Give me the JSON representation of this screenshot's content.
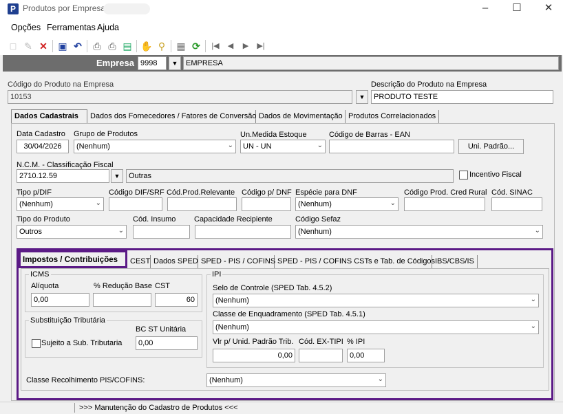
{
  "window": {
    "title": "Produtos por Empresa"
  },
  "menu": [
    "Opções",
    "Ferramentas",
    "Ajuda"
  ],
  "toolbar": {
    "icons": [
      "new-icon",
      "edit-icon",
      "delete-icon",
      "save-icon",
      "undo-icon",
      "print-icon",
      "print-setup-icon",
      "export-icon",
      "hand-icon",
      "search-icon",
      "settings-icon",
      "refresh-icon",
      "first-record-icon",
      "previous-record-icon",
      "next-record-icon",
      "last-record-icon"
    ]
  },
  "empresa": {
    "label": "Empresa",
    "code": "9998",
    "name": "EMPRESA"
  },
  "produto": {
    "code_label": "Código do Produto na Empresa",
    "code": "10153",
    "desc_label": "Descrição do Produto na Empresa",
    "desc": "PRODUTO TESTE"
  },
  "tabs": [
    "Dados Cadastrais",
    "Dados dos Fornecedores / Fatores de Conversão",
    "Dados de Movimentação",
    "Produtos Correlacionados"
  ],
  "cadastro": {
    "data_cadastro_label": "Data Cadastro",
    "data_cadastro": "30/04/2026",
    "grupo_label": "Grupo de Produtos",
    "grupo": "(Nenhum)",
    "unmed_label": "Un.Medida Estoque",
    "unmed": "UN - UN",
    "ean_label": "Código de Barras - EAN",
    "ean": "",
    "uni_padrao_btn": "Uni. Padrão...",
    "ncm_label": "N.C.M. -  Classificação Fiscal",
    "ncm": "2710.12.59",
    "ncm_desc": "Outras",
    "incentivo_label": "Incentivo Fiscal",
    "tipo_dif_label": "Tipo p/DIF",
    "tipo_dif": "(Nenhum)",
    "cod_dif_label": "Código DIF/SRF",
    "cod_prod_rel_label": "Cód.Prod.Relevante",
    "cod_dnf_label": "Código p/ DNF",
    "especie_dnf_label": "Espécie para DNF",
    "especie_dnf": "(Nenhum)",
    "cod_cred_rural_label": "Código Prod. Cred Rural",
    "cod_sinac_label": "Cód. SINAC",
    "tipo_produto_label": "Tipo do Produto",
    "tipo_produto": "Outros",
    "cod_insumo_label": "Cód. Insumo",
    "cap_recipiente_label": "Capacidade Recipiente",
    "cod_sefaz_label": "Código Sefaz",
    "cod_sefaz": "(Nenhum)"
  },
  "subtabs": [
    "Impostos / Contribuições",
    "CEST",
    "Dados SPED",
    "SPED - PIS / COFINS",
    "SPED - PIS / COFINS CSTs e Tab. de Códigos",
    "IBS/CBS/IS"
  ],
  "icms": {
    "title": "ICMS",
    "aliquota_label": "Alíquota",
    "aliquota": "0,00",
    "reducao_label": "% Redução Base",
    "reducao": "",
    "cst_label": "CST",
    "cst": "60"
  },
  "st": {
    "title": "Substituição Tributária",
    "sujeito_label": "Sujeito a Sub. Tributaria",
    "bc_label": "BC ST Unitária",
    "bc": "0,00"
  },
  "ipi": {
    "title": "IPI",
    "selo_label": "Selo de Controle (SPED Tab. 4.5.2)",
    "selo": "(Nenhum)",
    "classe_label": "Classe de Enquadramento (SPED Tab. 4.5.1)",
    "classe": "(Nenhum)",
    "vlr_label": "Vlr p/ Unid. Padrão Trib.",
    "vlr": "0,00",
    "extipi_label": "Cód. EX-TIPI",
    "extipi": "",
    "pct_label": "% IPI",
    "pct": "0,00"
  },
  "pis": {
    "label": "Classe Recolhimento PIS/COFINS:",
    "value": "(Nenhum)"
  },
  "status": {
    "text": ">>> Manutenção do Cadastro de Produtos <<<"
  },
  "colors": {
    "highlight": "#5b1a86",
    "empresa_bar": "#6d6d6d",
    "app_icon": "#1f3f8f"
  }
}
